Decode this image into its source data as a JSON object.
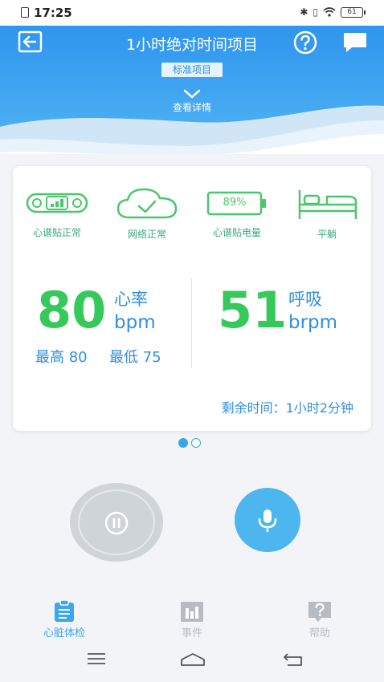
{
  "status_bar": {
    "time": "17:25",
    "battery": "61"
  },
  "header": {
    "title": "1小时绝对时间项目",
    "tag": "标准项目",
    "details_label": "查看详情"
  },
  "device_status": [
    {
      "icon": "patch-signal-icon",
      "label": "心谱贴正常"
    },
    {
      "icon": "cloud-check-icon",
      "label": "网络正常"
    },
    {
      "icon": "battery-icon",
      "label": "心谱贴电量",
      "value": "89%"
    },
    {
      "icon": "bed-icon",
      "label": "平躺"
    }
  ],
  "heart_rate": {
    "value": "80",
    "label": "心率",
    "unit": "bpm",
    "max": "最高 80",
    "min": "最低 75"
  },
  "respiration": {
    "value": "51",
    "label": "呼吸",
    "unit": "brpm"
  },
  "remaining_time": "剩余时间：1小时2分钟",
  "pagination": {
    "current": 1,
    "total": 2
  },
  "tabs": [
    {
      "label": "心脏体检",
      "icon": "clipboard-icon",
      "active": true
    },
    {
      "label": "事件",
      "icon": "bar-chart-icon",
      "active": false
    },
    {
      "label": "帮助",
      "icon": "question-icon",
      "active": false
    }
  ],
  "colors": {
    "accent_blue": "#2f8fe0",
    "header_blue": "#3a9ef0",
    "value_green": "#35c95a",
    "status_green": "#3ba87a",
    "mic_blue": "#4db6ee",
    "tab_inactive": "#b7bcc2"
  }
}
